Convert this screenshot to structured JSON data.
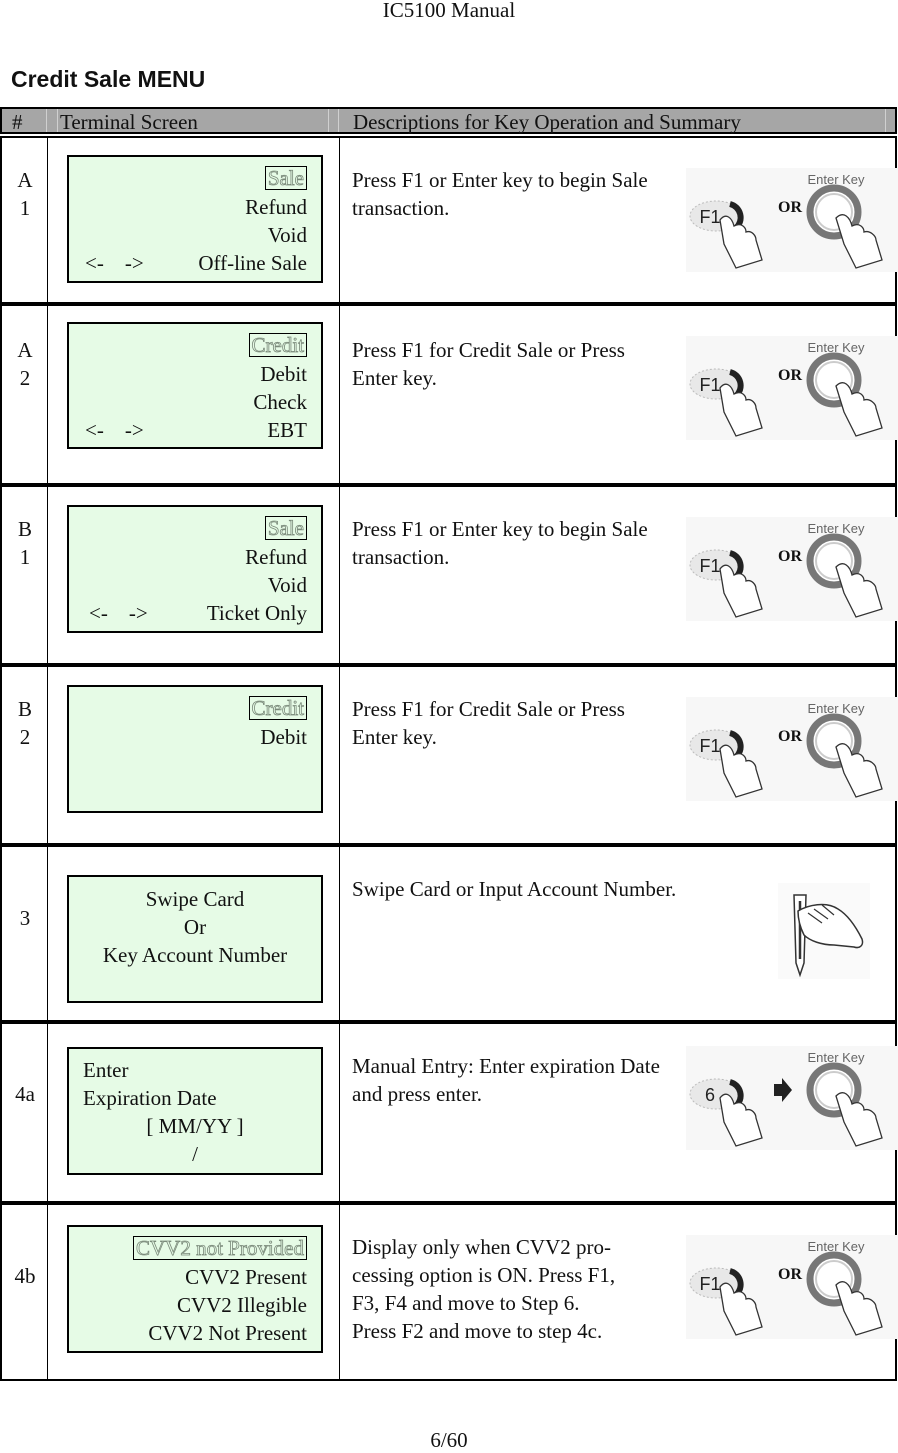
{
  "header": {
    "running_title": "IC5100 Manual"
  },
  "section_title": "Credit Sale MENU",
  "table": {
    "columns": [
      "#",
      "Terminal Screen",
      "Descriptions for Key Operation and Summary"
    ],
    "rows": [
      {
        "id_line1": "A",
        "id_line2": "1",
        "screen": {
          "highlight": "Sale",
          "lines": [
            "Refund",
            "Void",
            "Off-line Sale"
          ],
          "nav_left": "<-",
          "nav_right": "->"
        },
        "description": "Press F1 or Enter key to begin Sale transaction.",
        "key_image": {
          "type": "f1-or-enter",
          "key_label": "F1",
          "connector": "OR",
          "enter_label": "Enter Key"
        }
      },
      {
        "id_line1": "A",
        "id_line2": "2",
        "screen": {
          "highlight": "Credit",
          "lines": [
            "Debit",
            "Check",
            "EBT"
          ],
          "nav_left": "<-",
          "nav_right": "->"
        },
        "description": "Press F1 for Credit Sale or Press Enter key.",
        "key_image": {
          "type": "f1-or-enter",
          "key_label": "F1",
          "connector": "OR",
          "enter_label": "Enter Key"
        }
      },
      {
        "id_line1": "B",
        "id_line2": "1",
        "screen": {
          "highlight": "Sale",
          "lines": [
            "Refund",
            "Void",
            "Ticket Only"
          ],
          "nav_left": "<-",
          "nav_right": "->"
        },
        "description": "Press F1 or Enter key to begin Sale transaction.",
        "key_image": {
          "type": "f1-or-enter",
          "key_label": "F1",
          "connector": "OR",
          "enter_label": "Enter Key"
        }
      },
      {
        "id_line1": "B",
        "id_line2": "2",
        "screen": {
          "highlight": "Credit",
          "lines": [
            "Debit"
          ]
        },
        "description": "Press F1 for Credit Sale or Press Enter key.",
        "key_image": {
          "type": "f1-or-enter",
          "key_label": "F1",
          "connector": "OR",
          "enter_label": "Enter Key"
        }
      },
      {
        "id_line1": "3",
        "screen": {
          "lines": [
            "Swipe Card",
            "Or",
            "Key Account Number"
          ]
        },
        "description": "Swipe Card or Input Account Number.",
        "key_image": {
          "type": "card-swipe"
        }
      },
      {
        "id_line1": "4a",
        "screen": {
          "lines": [
            "Enter",
            "Expiration Date",
            "[ MM/YY ]",
            "/"
          ]
        },
        "description": "Manual Entry:  Enter expiration Date and press enter.",
        "key_image": {
          "type": "6-then-enter",
          "key_label": "6",
          "connector": "arrow",
          "enter_label": "Enter Key"
        }
      },
      {
        "id_line1": "4b",
        "screen": {
          "highlight": "CVV2 not Provided",
          "lines": [
            "CVV2 Present",
            "CVV2 Illegible",
            "CVV2 Not Present"
          ]
        },
        "description_lines": [
          "Display only when CVV2 pro-",
          "cessing option is ON. Press F1,",
          "F3, F4 and move to Step 6.",
          "Press F2 and move to step 4c."
        ],
        "key_image": {
          "type": "f1-or-enter",
          "key_label": "F1",
          "connector": "OR",
          "enter_label": "Enter Key"
        }
      }
    ]
  },
  "footer": {
    "page_number": "6/60"
  }
}
